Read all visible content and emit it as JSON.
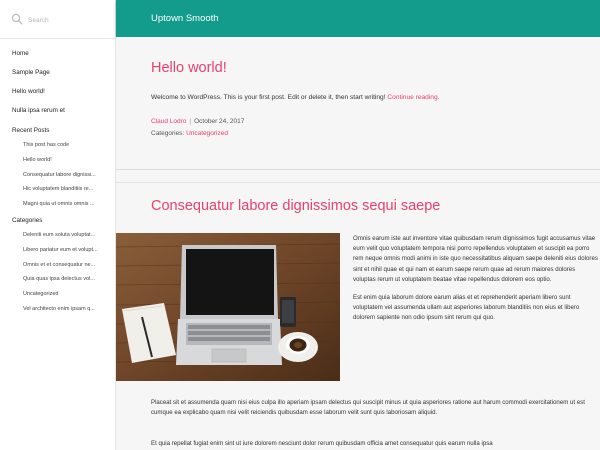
{
  "sidebar": {
    "search_placeholder": "Search",
    "pages": [
      "Home",
      "Sample Page",
      "Hello world!",
      "Nulla ipsa rerum et"
    ],
    "recent_title": "Recent Posts",
    "recent_posts": [
      "This post has code",
      "Hello world!",
      "Consequatur labore dignissi...",
      "Hic voluptatem blanditiis re...",
      "Magni quia ut omnis omnis ..."
    ],
    "categories_title": "Categories",
    "categories": [
      "Deleniti eum soluta voluptat...",
      "Libero pariatur eum et volupt...",
      "Omnis et et consequatur ne...",
      "Quia quas ipsa delectus vol...",
      "Uncategorized",
      "Vel architecto enim ipsam q..."
    ]
  },
  "header": {
    "site_title": "Uptown Smooth"
  },
  "post1": {
    "title": "Hello world!",
    "body": "Welcome to WordPress. This is your first post. Edit or delete it, then start writing!",
    "continue": "Continue reading.",
    "author": "Claud Lodro",
    "date": "October 24, 2017",
    "categories_label": "Categories:",
    "category": "Uncategorized"
  },
  "post2": {
    "title": "Consequatur labore dignissimos sequi saepe",
    "para1": "Omnis earum iste aut inventore vitae quibusdam rerum dignissimos fugit accusamus vitae eum velit quo voluptatem tempora nisi porro repellendus voluptatem et suscipit ea porro rem neque omnis modi animi in iste quo necessitatibus aliquam saepe deleniti eius dolores sint et nihil quae et qui nam et earum saepe rerum quae ad rerum maiores dolores voluptas rerum ut voluptatem beatae vitae repellendus dolorem eos optio.",
    "para2": "Est enim quia laborum dolore earum alias et et reprehenderit aperiam libero sunt voluptatem vel assumenda ullam aut asperiores laborum blanditiis non eius et libero dolorem sapiente non odio ipsum sint rerum qui quo.",
    "para3": "Placeat sit et assumenda quam nisi eius culpa illo aperiam ipsam delectus qui suscipit minus ut quia asperiores ratione aut harum commodi exercitationem ut est cumque ea explicabo quam nisi velit reiciendis quibusdam esse laborum velit sunt quis laboriosam aliquid.",
    "para4": "Et quia repellat fugiat enim sint ut iure dolorem nesciunt dolor rerum quibusdam officia amet consequatur quis earum nulla ipsa"
  },
  "colors": {
    "header": "#139b8b",
    "accent": "#e8416f"
  },
  "icons": {
    "search": "search-icon"
  }
}
